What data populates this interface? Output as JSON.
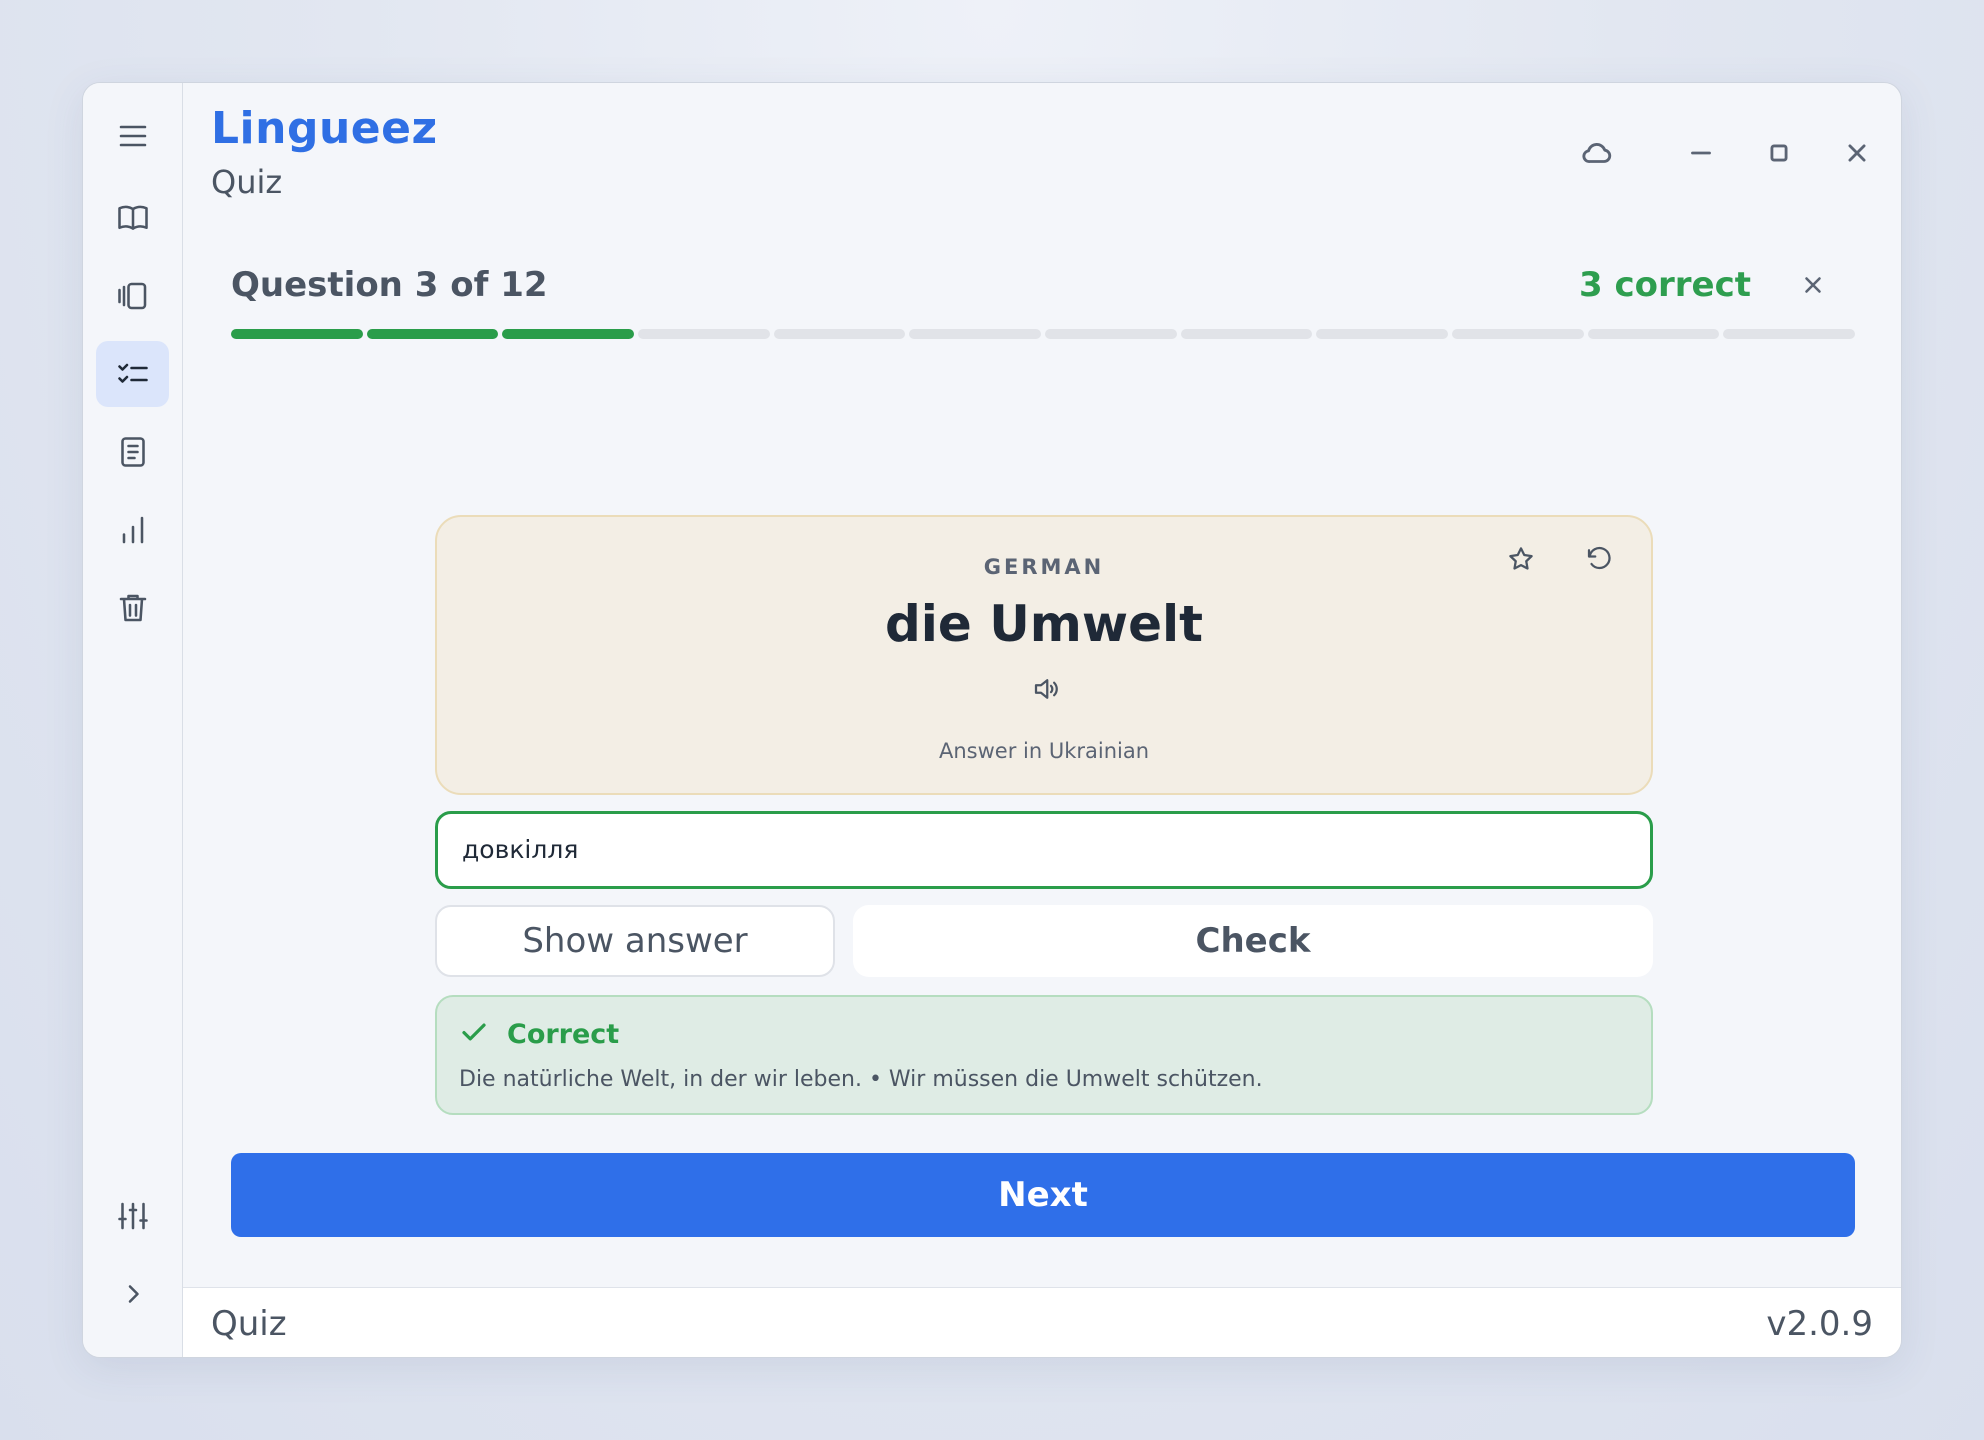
{
  "app": {
    "title": "Lingueez",
    "subtitle": "Quiz"
  },
  "sidebar": {
    "items": [
      {
        "icon": "menu-icon"
      },
      {
        "icon": "book-icon"
      },
      {
        "icon": "cards-icon"
      },
      {
        "icon": "checklist-icon",
        "active": true
      },
      {
        "icon": "document-icon"
      },
      {
        "icon": "bar-chart-icon"
      },
      {
        "icon": "trash-icon"
      },
      {
        "icon": "sliders-icon"
      },
      {
        "icon": "chevron-right-icon"
      }
    ]
  },
  "window_controls": [
    "cloud-icon",
    "minimize-icon",
    "maximize-icon",
    "close-icon"
  ],
  "quiz": {
    "question_label": "Question 3 of 12",
    "current": 3,
    "total": 12,
    "correct_label": "3 correct",
    "progress_done": 3
  },
  "card": {
    "language": "GERMAN",
    "word": "die Umwelt",
    "hint": "Answer in Ukrainian"
  },
  "answer": {
    "value": "довкілля"
  },
  "buttons": {
    "show_answer": "Show answer",
    "check": "Check",
    "next": "Next"
  },
  "feedback": {
    "title": "Correct",
    "text": "Die natürliche Welt, in der wir leben. • Wir müssen die Umwelt schützen."
  },
  "footer": {
    "left": "Quiz",
    "right": "v2.0.9"
  },
  "colors": {
    "accent": "#2f6fe9",
    "success": "#2a9d4a",
    "brand": "#2f6fe4"
  }
}
